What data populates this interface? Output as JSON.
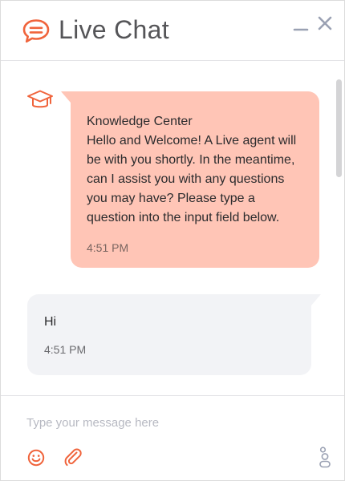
{
  "header": {
    "title": "Live Chat",
    "logo_icon": "chat-bubble-icon",
    "minimize_icon": "minimize-icon",
    "close_icon": "close-icon"
  },
  "messages": [
    {
      "from": "bot",
      "avatar_icon": "graduation-cap-icon",
      "sender": "Knowledge Center",
      "text": "Hello and Welcome! A Live agent will be with you shortly. In the meantime, can I assist you with any questions you may have? Please type a question into the input field below.",
      "time": "4:51 PM"
    },
    {
      "from": "user",
      "text": "Hi",
      "time": "4:51 PM"
    }
  ],
  "composer": {
    "placeholder": "Type your message here",
    "value": "",
    "emoji_icon": "smiley-icon",
    "attach_icon": "paperclip-icon",
    "brand_icon": "brand-logo-icon"
  },
  "colors": {
    "accent": "#f0643c",
    "bot_bubble": "#ffc5b6",
    "user_bubble": "#f2f3f6",
    "title_text": "#555558",
    "icon_gray": "#9aa1b3"
  }
}
